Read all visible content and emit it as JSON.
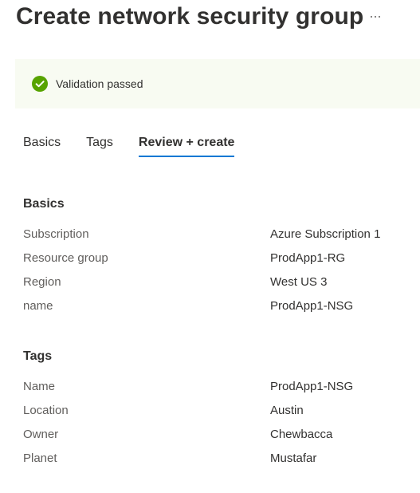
{
  "header": {
    "title": "Create network security group",
    "more_icon": "ellipsis-icon"
  },
  "banner": {
    "status_icon": "check-circle-icon",
    "status_color": "#57a300",
    "message": "Validation passed"
  },
  "tabs": [
    {
      "label": "Basics",
      "selected": false
    },
    {
      "label": "Tags",
      "selected": false
    },
    {
      "label": "Review + create",
      "selected": true
    }
  ],
  "accent_color": "#0078d4",
  "basics": {
    "title": "Basics",
    "rows": [
      {
        "label": "Subscription",
        "value": "Azure Subscription 1"
      },
      {
        "label": "Resource group",
        "value": "ProdApp1-RG"
      },
      {
        "label": "Region",
        "value": "West US 3"
      },
      {
        "label": "name",
        "value": "ProdApp1-NSG"
      }
    ]
  },
  "tags": {
    "title": "Tags",
    "rows": [
      {
        "label": "Name",
        "value": "ProdApp1-NSG"
      },
      {
        "label": "Location",
        "value": "Austin"
      },
      {
        "label": "Owner",
        "value": "Chewbacca"
      },
      {
        "label": "Planet",
        "value": "Mustafar"
      }
    ]
  }
}
